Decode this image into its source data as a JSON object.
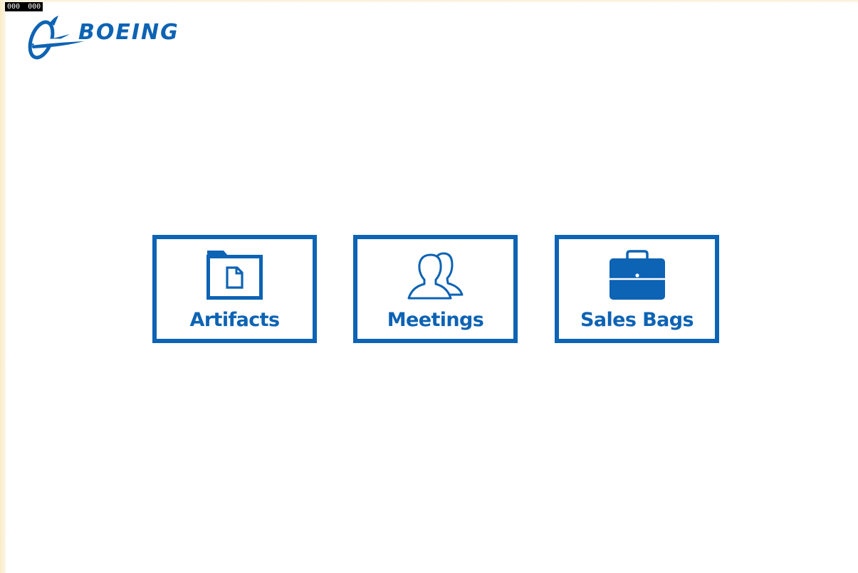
{
  "debug": {
    "counter_left": "000",
    "counter_right": "000"
  },
  "brand": {
    "name": "BOEING",
    "color": "#0d63b4"
  },
  "tiles": [
    {
      "label": "Artifacts",
      "icon": "folder-document-icon"
    },
    {
      "label": "Meetings",
      "icon": "people-icon"
    },
    {
      "label": "Sales Bags",
      "icon": "briefcase-icon"
    }
  ],
  "colors": {
    "accent": "#0d63b4",
    "background": "#ffffff"
  }
}
